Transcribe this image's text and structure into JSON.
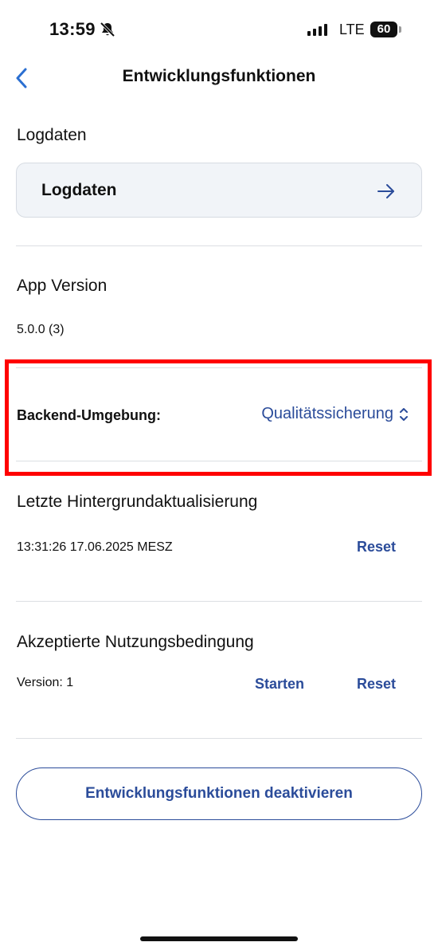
{
  "status_bar": {
    "time": "13:59",
    "network": "LTE",
    "battery": "60"
  },
  "nav": {
    "title": "Entwicklungsfunktionen"
  },
  "logdaten": {
    "heading": "Logdaten",
    "button_label": "Logdaten"
  },
  "app_version": {
    "heading": "App Version",
    "value": "5.0.0 (3)"
  },
  "backend": {
    "label": "Backend-Umgebung:",
    "value": "Qualitätssicherung"
  },
  "background_update": {
    "heading": "Letzte Hintergrundaktualisierung",
    "timestamp": "13:31:26 17.06.2025 MESZ",
    "reset_label": "Reset"
  },
  "terms": {
    "heading": "Akzeptierte Nutzungsbedingung",
    "version": "Version: 1",
    "start_label": "Starten",
    "reset_label": "Reset"
  },
  "footer": {
    "deactivate_label": "Entwicklungsfunktionen deaktivieren"
  },
  "colors": {
    "accent": "#2b4c9a",
    "highlight": "#ff0000",
    "card_bg": "#f1f4f8"
  },
  "icons": {
    "back": "chevron-left-icon",
    "arrow": "arrow-right-icon",
    "picker": "chevron-up-down-icon",
    "bell": "bell-slash-icon"
  }
}
